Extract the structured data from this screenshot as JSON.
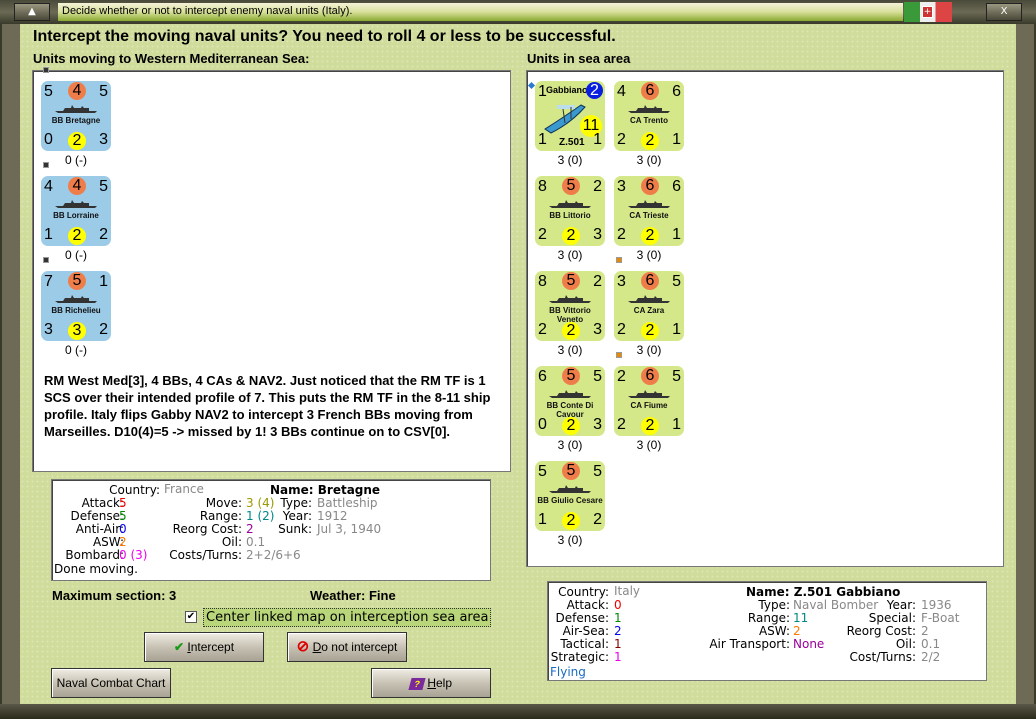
{
  "window": {
    "title": "Decide whether or not to intercept enemy naval units (Italy).",
    "min_glyph": "▲",
    "close_glyph": "X",
    "flag_glyph": "+"
  },
  "heading": "Intercept the moving naval units?  You need to roll 4 or less to be successful.",
  "left": {
    "title": "Units moving to Western Mediterranean Sea:",
    "units": [
      {
        "name": "BB Bretagne",
        "tl": "5",
        "tc": "4",
        "tr": "5",
        "bl": "0",
        "bc": "2",
        "br": "3",
        "label": "0 (-)"
      },
      {
        "name": "BB Lorraine",
        "tl": "4",
        "tc": "4",
        "tr": "5",
        "bl": "1",
        "bc": "2",
        "br": "2",
        "label": "0 (-)"
      },
      {
        "name": "BB Richelieu",
        "tl": "7",
        "tc": "5",
        "tr": "1",
        "bl": "3",
        "bc": "3",
        "br": "2",
        "label": "0 (-)"
      }
    ],
    "notes": "RM West Med[3], 4 BBs, 4 CAs & NAV2.  Just noticed that the RM TF is 1 SCS over their intended profile of 7.  This puts the RM TF in the 8-11 ship profile.  Italy flips Gabby NAV2 to intercept 3 French BBs moving from Marseilles.  D10(4)=5 -> missed by 1!   3 BBs continue on to CSV[0]."
  },
  "right": {
    "title": "Units in sea area",
    "air": {
      "name_top": "Gabbiano",
      "name_bottom": "Z.501",
      "tl": "1",
      "tc": "2",
      "range": "11",
      "bl": "1",
      "br": "1",
      "label": "3 (0)"
    },
    "col1": [
      {
        "name": "BB Littorio",
        "tl": "8",
        "tc": "5",
        "tr": "2",
        "bl": "2",
        "bc": "2",
        "br": "3",
        "label": "3 (0)"
      },
      {
        "name": "BB Vittorio Veneto",
        "tl": "8",
        "tc": "5",
        "tr": "2",
        "bl": "2",
        "bc": "2",
        "br": "3",
        "label": "3 (0)"
      },
      {
        "name": "BB Conte Di Cavour",
        "tl": "6",
        "tc": "5",
        "tr": "5",
        "bl": "0",
        "bc": "2",
        "br": "3",
        "label": "3 (0)"
      },
      {
        "name": "BB Giulio Cesare",
        "tl": "5",
        "tc": "5",
        "tr": "5",
        "bl": "1",
        "bc": "2",
        "br": "2",
        "label": "3 (0)"
      }
    ],
    "col2": [
      {
        "name": "CA Trento",
        "tl": "4",
        "tc": "6",
        "tr": "6",
        "bl": "2",
        "bc": "2",
        "br": "1",
        "label": "3 (0)"
      },
      {
        "name": "CA Trieste",
        "tl": "3",
        "tc": "6",
        "tr": "6",
        "bl": "2",
        "bc": "2",
        "br": "1",
        "label": "3 (0)"
      },
      {
        "name": "CA Zara",
        "tl": "3",
        "tc": "6",
        "tr": "5",
        "bl": "2",
        "bc": "2",
        "br": "1",
        "label": "3 (0)"
      },
      {
        "name": "CA Fiume",
        "tl": "2",
        "tc": "6",
        "tr": "5",
        "bl": "2",
        "bc": "2",
        "br": "1",
        "label": "3 (0)"
      }
    ]
  },
  "left_info": {
    "country_l": "Country:",
    "country": "France",
    "attack_l": "Attack:",
    "attack": "5",
    "defense_l": "Defense:",
    "defense": "5",
    "aa_l": "Anti-Air:",
    "aa": "0",
    "asw_l": "ASW:",
    "asw": "2",
    "bombard_l": "Bombard:",
    "bombard": "0 (3)",
    "status": "Done moving.",
    "name": "Name: Bretagne",
    "move_l": "Move:",
    "move": "3 (4)",
    "range_l": "Range:",
    "range": "1 (2)",
    "reorg_l": "Reorg Cost:",
    "reorg": "2",
    "oil_l": "Oil:",
    "oil": "0.1",
    "costs_l": "Costs/Turns:",
    "costs": "2+2/6+6",
    "type_l": "Type:",
    "type": "Battleship",
    "year_l": "Year:",
    "year": "1912",
    "sunk_l": "Sunk:",
    "sunk": "Jul 3, 1940"
  },
  "right_info": {
    "country_l": "Country:",
    "country": "Italy",
    "attack_l": "Attack:",
    "attack": "0",
    "defense_l": "Defense:",
    "defense": "1",
    "airsea_l": "Air-Sea:",
    "airsea": "2",
    "tactical_l": "Tactical:",
    "tactical": "1",
    "strategic_l": "Strategic:",
    "strategic": "1",
    "status": "Flying",
    "name": "Name: Z.501 Gabbiano",
    "type_l": "Type:",
    "type": "Naval Bomber",
    "range_l": "Range:",
    "range": "11",
    "asw_l": "ASW:",
    "asw": "2",
    "airtrans_l": "Air Transport:",
    "airtrans": "None",
    "year_l": "Year:",
    "year": "1936",
    "special_l": "Special:",
    "special": "F-Boat",
    "reorg_l": "Reorg Cost:",
    "reorg": "2",
    "oil_l": "Oil:",
    "oil": "0.1",
    "cost_l": "Cost/Turns:",
    "cost": "2/2"
  },
  "max_section": "Maximum section: 3",
  "weather": "Weather:  Fine",
  "center_checkbox": {
    "label": "Center linked map on interception sea area",
    "checked": true,
    "glyph": "✔"
  },
  "buttons": {
    "intercept_u": "I",
    "intercept": "ntercept",
    "no_u": "D",
    "no": "o not intercept",
    "chart": "Naval Combat Chart",
    "help_u": "H",
    "help": "elp",
    "check_glyph": "✔",
    "no_glyph": "⊘",
    "help_glyph": "?"
  }
}
